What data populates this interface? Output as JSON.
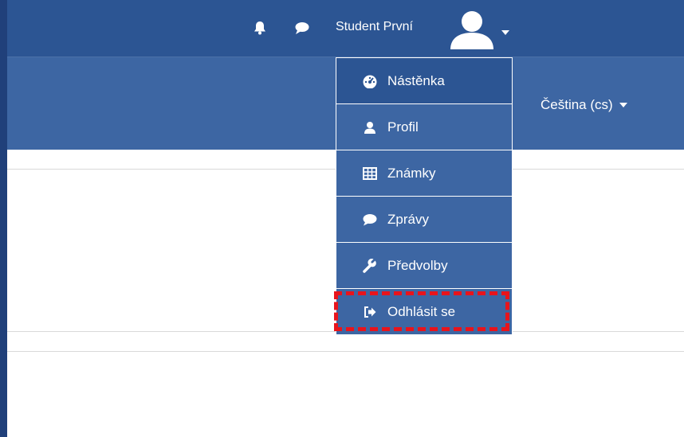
{
  "topbar": {
    "user_name": "Student První",
    "icons": [
      "bell-icon",
      "chat-icon",
      "user-avatar-icon",
      "caret-down-icon"
    ]
  },
  "navbar": {
    "language_label": "Čeština (cs)"
  },
  "user_menu": {
    "items": [
      {
        "label": "Nástěnka",
        "icon": "dashboard-icon"
      },
      {
        "label": "Profil",
        "icon": "user-icon"
      },
      {
        "label": "Známky",
        "icon": "table-icon"
      },
      {
        "label": "Zprávy",
        "icon": "chat-icon"
      },
      {
        "label": "Předvolby",
        "icon": "wrench-icon"
      },
      {
        "label": "Odhlásit se",
        "icon": "sign-out-icon"
      }
    ],
    "highlighted_item": "Odhlásit se"
  },
  "colors": {
    "topbar": "#2c5593",
    "navbar": "#3d66a3",
    "menu_active": "#2c5593",
    "highlight": "#e8141c"
  }
}
